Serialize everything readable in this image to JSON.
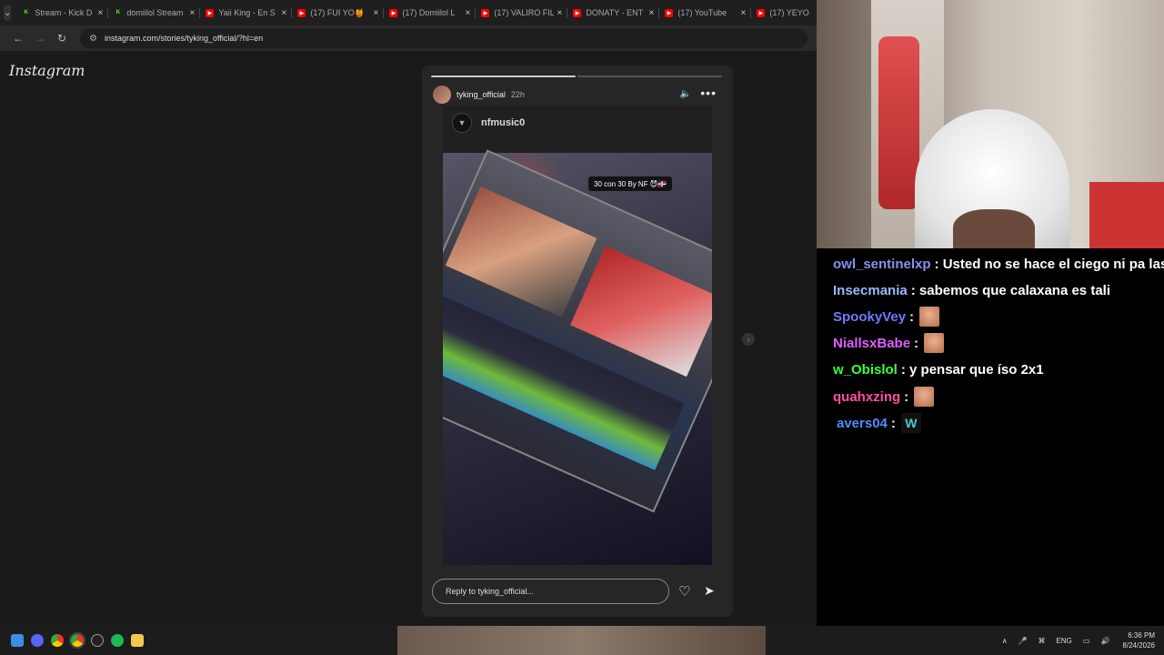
{
  "browser": {
    "tabs": [
      {
        "title": "Stream - Kick D",
        "color": "#53fc18",
        "glyph": "K"
      },
      {
        "title": "domiilol Stream",
        "color": "#53fc18",
        "glyph": "K"
      },
      {
        "title": "Yaii King - En S",
        "color": "#ff0000",
        "glyph": "▶"
      },
      {
        "title": "(17) FUI YO🍯",
        "color": "#ff0000",
        "glyph": "▶"
      },
      {
        "title": "(17) Domiilol L",
        "color": "#ff0000",
        "glyph": "▶"
      },
      {
        "title": "(17) VALIRO FIL",
        "color": "#ff0000",
        "glyph": "▶"
      },
      {
        "title": "DONATY - ENT",
        "color": "#ff0000",
        "glyph": "▶"
      },
      {
        "title": "(17) YouTube",
        "color": "#ff0000",
        "glyph": "▶"
      },
      {
        "title": "(17) YEYO",
        "color": "#ff0000",
        "glyph": "▶"
      }
    ],
    "url": "instagram.com/stories/tyking_official/?hl=en"
  },
  "instagram": {
    "logo": "Instagram",
    "story": {
      "username": "tyking_official",
      "time": "22h",
      "progress_done": 1,
      "progress_total": 2,
      "media_account": "nfmusic0",
      "caption": "30 con 30 By NF 😈🇩🇴",
      "reply_placeholder": "Reply to tyking_official..."
    }
  },
  "chat": {
    "messages": [
      {
        "user": "owl_sentinelxp",
        "color": "#8a8ff0",
        "text": ": Usted no se hace el ciego ni pa las",
        "emote": ""
      },
      {
        "user": "Insecmania",
        "color": "#9bb8ff",
        "text": ": sabemos que calaxana es tali",
        "emote": ""
      },
      {
        "user": "SpookyVey",
        "color": "#6c7bff",
        "text": ":",
        "emote": "face"
      },
      {
        "user": "NiallsxBabe",
        "color": "#e05cff",
        "text": ":",
        "emote": "face"
      },
      {
        "user": "w_Obislol",
        "color": "#3cff3c",
        "text": ": y pensar que íso 2x1",
        "emote": ""
      },
      {
        "user": "quahxzing",
        "color": "#ff4fa3",
        "text": ":",
        "emote": "face"
      },
      {
        "user": "avers04",
        "color": "#4f8cff",
        "text": ":",
        "emote": "w"
      }
    ]
  },
  "taskbar": {
    "lang": "ENG",
    "time": "6:36 PM",
    "date": "8/24/2026"
  }
}
